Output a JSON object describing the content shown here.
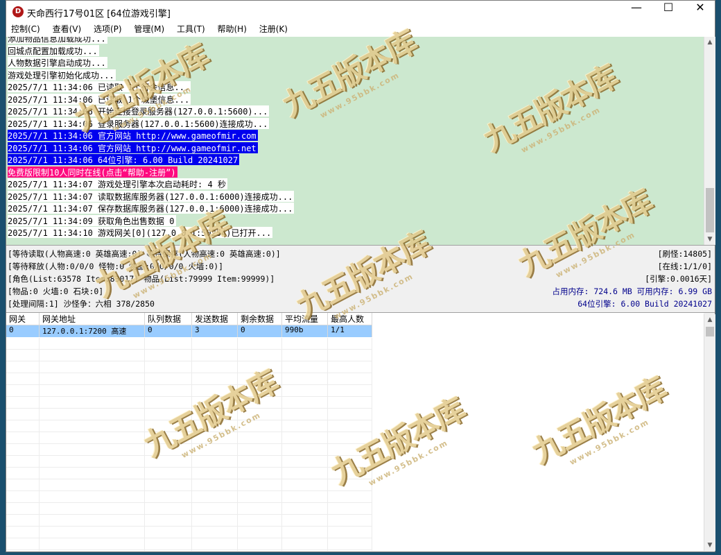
{
  "window": {
    "title": "天命西行17号01区 [64位游戏引擎]",
    "icon_letter": "D",
    "controls": {
      "minimize": "—",
      "maximize": "☐",
      "close": "✕"
    }
  },
  "menu": [
    "控制(C)",
    "查看(V)",
    "选项(P)",
    "管理(M)",
    "工具(T)",
    "帮助(H)",
    "注册(K)"
  ],
  "log": [
    {
      "text": "添加物品信息加载成功...",
      "style": "normal"
    },
    {
      "text": "回城点配置加载成功...",
      "style": "normal"
    },
    {
      "text": "人物数据引擎启动成功...",
      "style": "normal"
    },
    {
      "text": "游戏处理引擎初始化成功...",
      "style": "normal"
    },
    {
      "text": "2025/7/1 11:34:06 已读取 1个行会信息...",
      "style": "normal"
    },
    {
      "text": "2025/7/1 11:34:06 已读取 1个城堡信息...",
      "style": "normal"
    },
    {
      "text": "2025/7/1 11:34:06 开始连接登录服务器(127.0.0.1:5600)...",
      "style": "normal"
    },
    {
      "text": "2025/7/1 11:34:06 登录服务器(127.0.0.1:5600)连接成功...",
      "style": "normal"
    },
    {
      "text": "2025/7/1 11:34:06 官方网站 http://www.gameofmir.com",
      "style": "blue"
    },
    {
      "text": "2025/7/1 11:34:06 官方网站 http://www.gameofmir.net",
      "style": "blue"
    },
    {
      "text": "2025/7/1 11:34:06 64位引擎: 6.00 Build 20241027",
      "style": "blue"
    },
    {
      "text": "免费版限制10人同时在线(点击“帮助-注册”)",
      "style": "pink"
    },
    {
      "text": "2025/7/1 11:34:07 游戏处理引擎本次启动耗时: 4 秒",
      "style": "normal"
    },
    {
      "text": "2025/7/1 11:34:07 读取数据库服务器(127.0.0.1:6000)连接成功...",
      "style": "normal"
    },
    {
      "text": "2025/7/1 11:34:07 保存数据库服务器(127.0.0.1:6000)连接成功...",
      "style": "normal"
    },
    {
      "text": "2025/7/1 11:34:09 获取角色出售数据 0",
      "style": "normal"
    },
    {
      "text": "2025/7/1 11:34:10 游戏网关[0](127.0.0.1:50254)已打开...",
      "style": "normal"
    }
  ],
  "status": {
    "left": [
      "[等待读取(人物高速:0 英雄高速:0) 等待保存(人物高速:0 英雄高速:0)]",
      "[等待释放(人物:0/0/0 怪物:0 物品:0/0/0/0 火墙:0)]",
      "[角色(List:63578 Item:83017) 物品(List:79999 Item:99999)]",
      "[物品:0 火墙:0 石块:0]",
      "[处理间隔:1]      沙怪争：六相 378/2850"
    ],
    "right": [
      "[刷怪:14805]",
      "[在线:1/1/0]",
      "[引擎:0.0016天]",
      "占用内存: 724.6 MB 可用内存: 6.99 GB",
      "64位引擎: 6.00 Build 20241027"
    ]
  },
  "grid": {
    "headers": [
      "网关",
      "网关地址",
      "队列数据",
      "发送数据",
      "剩余数据",
      "平均流量",
      "最高人数"
    ],
    "rows": [
      [
        "0",
        "127.0.0.1:7200 高速",
        "0",
        "3",
        "0",
        "990b",
        "1/1"
      ]
    ]
  },
  "watermark": {
    "main": "九五版本库",
    "sub": "www.95bbk.com"
  }
}
